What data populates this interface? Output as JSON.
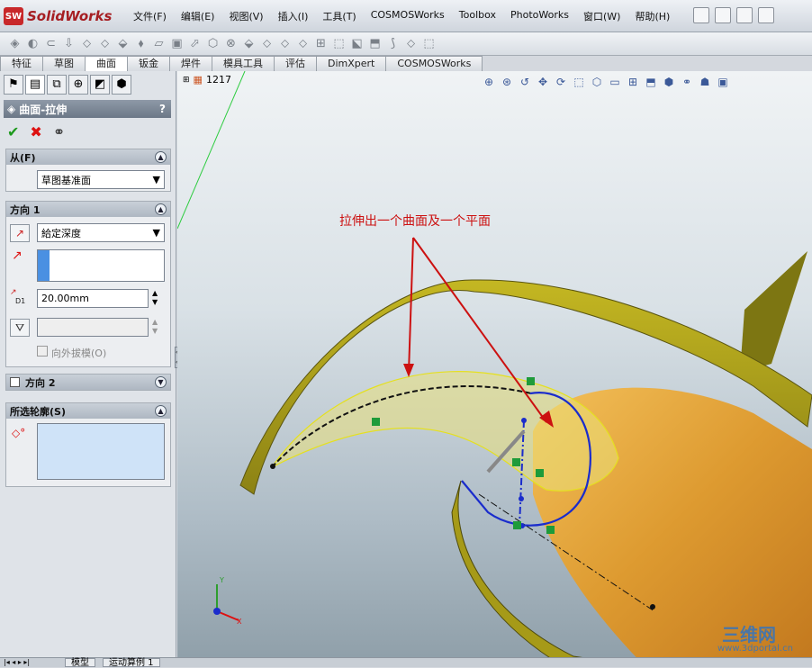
{
  "app": {
    "logo_badge": "SW",
    "logo_name": "SolidWorks"
  },
  "menu": [
    "文件(F)",
    "编辑(E)",
    "视图(V)",
    "插入(I)",
    "工具(T)",
    "COSMOSWorks",
    "Toolbox",
    "PhotoWorks",
    "窗口(W)",
    "帮助(H)"
  ],
  "tabs": [
    "特征",
    "草图",
    "曲面",
    "钣金",
    "焊件",
    "模具工具",
    "评估",
    "DimXpert",
    "COSMOSWorks"
  ],
  "active_tab": "曲面",
  "feature": {
    "title": "曲面-拉伸",
    "help": "?"
  },
  "from_group": {
    "title": "从(F)",
    "value": "草图基准面"
  },
  "dir1_group": {
    "title": "方向 1",
    "end_condition": "給定深度",
    "depth": "20.00mm",
    "depth_icon_label": "D1",
    "draft_checkbox": "向外拔模(O)"
  },
  "dir2_group": {
    "title": "方向 2"
  },
  "contours_group": {
    "title": "所选轮廓(S)"
  },
  "tree": {
    "count": "1217"
  },
  "annotation": {
    "text": "拉伸出一个曲面及一个平面",
    "color": "#cc1111"
  },
  "bottom_tabs": [
    "模型",
    "运动算例 1"
  ],
  "watermark": {
    "main": "三维网",
    "sub": "www.3dportal.cn"
  },
  "colors": {
    "surface": "#b9ad1d",
    "surface_dark": "#6f6a10",
    "tube": "#e1a53c",
    "sketch_blue": "#1a2ccc",
    "annotation_red": "#cc1111"
  }
}
